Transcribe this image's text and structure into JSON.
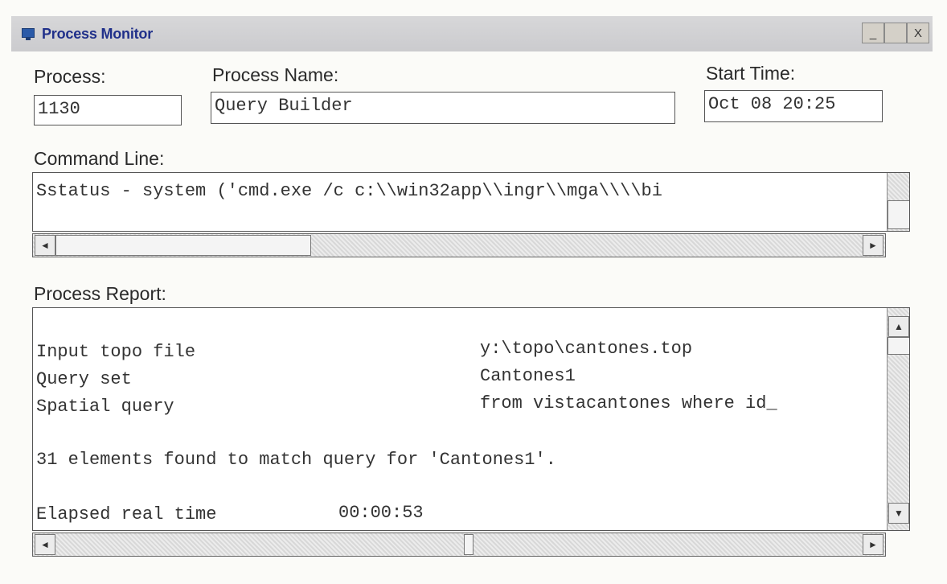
{
  "window": {
    "title": "Process Monitor",
    "icon": "monitor-icon",
    "controls": {
      "minimize": "_",
      "maximize": "",
      "close": "X"
    }
  },
  "fields": {
    "process_label": "Process:",
    "process_value": "1130",
    "process_name_label": "Process Name:",
    "process_name_value": "Query Builder",
    "start_time_label": "Start Time:",
    "start_time_value": "Oct 08 20:25",
    "command_line_label": "Command Line:",
    "command_line_value": "Sstatus - system ('cmd.exe /c c:\\\\win32app\\\\ingr\\\\mga\\\\\\\\bi"
  },
  "report": {
    "label": "Process Report:",
    "rows": [
      {
        "key": "Input topo file",
        "value": "y:\\topo\\cantones.top"
      },
      {
        "key": "Query set",
        "value": "Cantones1"
      },
      {
        "key": "Spatial query",
        "value": "from vistacantones where id_"
      }
    ],
    "summary": "31 elements found to match query for 'Cantones1'.",
    "elapsed_label": "Elapsed real time",
    "elapsed_value": "00:00:53"
  },
  "scrollbars": {
    "left_arrow": "◄",
    "right_arrow": "►",
    "up_arrow": "▲",
    "down_arrow": "▼"
  }
}
